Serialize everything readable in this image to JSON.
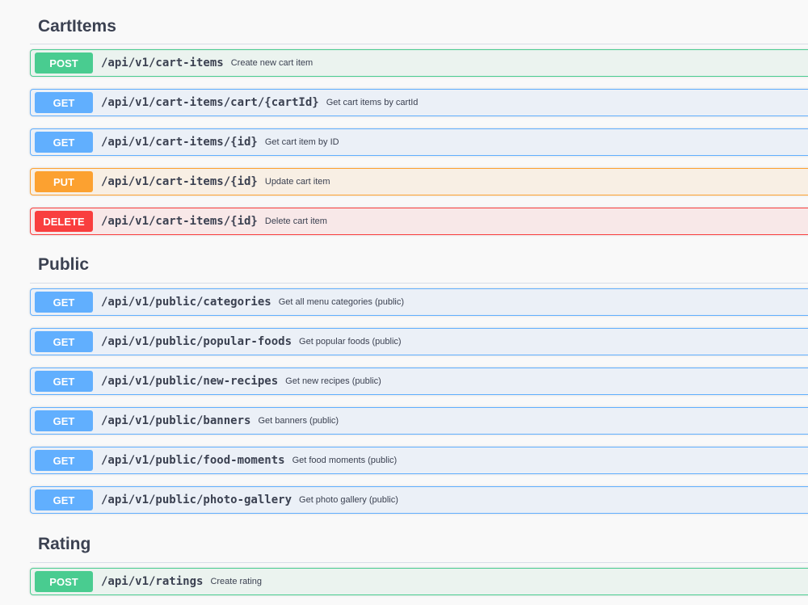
{
  "sections": [
    {
      "title": "CartItems",
      "operations": [
        {
          "method": "POST",
          "path": "/api/v1/cart-items",
          "summary": "Create new cart item"
        },
        {
          "method": "GET",
          "path": "/api/v1/cart-items/cart/{cartId}",
          "summary": "Get cart items by cartId"
        },
        {
          "method": "GET",
          "path": "/api/v1/cart-items/{id}",
          "summary": "Get cart item by ID"
        },
        {
          "method": "PUT",
          "path": "/api/v1/cart-items/{id}",
          "summary": "Update cart item"
        },
        {
          "method": "DELETE",
          "path": "/api/v1/cart-items/{id}",
          "summary": "Delete cart item"
        }
      ]
    },
    {
      "title": "Public",
      "operations": [
        {
          "method": "GET",
          "path": "/api/v1/public/categories",
          "summary": "Get all menu categories (public)"
        },
        {
          "method": "GET",
          "path": "/api/v1/public/popular-foods",
          "summary": "Get popular foods (public)"
        },
        {
          "method": "GET",
          "path": "/api/v1/public/new-recipes",
          "summary": "Get new recipes (public)"
        },
        {
          "method": "GET",
          "path": "/api/v1/public/banners",
          "summary": "Get banners (public)"
        },
        {
          "method": "GET",
          "path": "/api/v1/public/food-moments",
          "summary": "Get food moments (public)"
        },
        {
          "method": "GET",
          "path": "/api/v1/public/photo-gallery",
          "summary": "Get photo gallery (public)"
        }
      ]
    },
    {
      "title": "Rating",
      "operations": [
        {
          "method": "POST",
          "path": "/api/v1/ratings",
          "summary": "Create rating"
        }
      ]
    }
  ],
  "colors": {
    "post": "#49cc90",
    "get": "#61affe",
    "put": "#fca130",
    "delete": "#f93e3e",
    "text": "#3b4151"
  }
}
